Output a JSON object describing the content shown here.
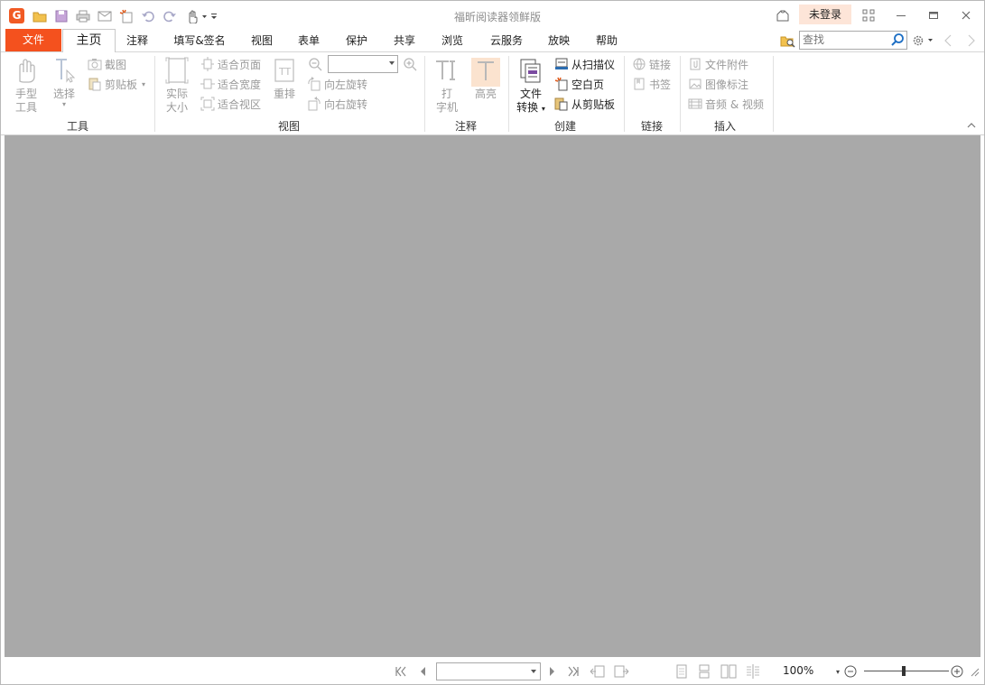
{
  "window": {
    "title": "福昕阅读器领鲜版"
  },
  "titlebar": {
    "logo_letter": "G",
    "login_label": "未登录"
  },
  "tabs": {
    "file": "文件",
    "items": [
      "主页",
      "注释",
      "填写&签名",
      "视图",
      "表单",
      "保护",
      "共享",
      "浏览",
      "云服务",
      "放映",
      "帮助"
    ],
    "active": "主页"
  },
  "search": {
    "placeholder": "查找"
  },
  "ribbon": {
    "tools": {
      "label": "工具",
      "hand_line1": "手型",
      "hand_line2": "工具",
      "select": "选择",
      "snapshot": "截图",
      "clipboard": "剪贴板"
    },
    "view": {
      "label": "视图",
      "actual_line1": "实际",
      "actual_line2": "大小",
      "fit_page": "适合页面",
      "fit_width": "适合宽度",
      "fit_visible": "适合视区",
      "reflow": "重排",
      "rotate_left": "向左旋转",
      "rotate_right": "向右旋转"
    },
    "comment": {
      "label": "注释",
      "typewriter_line1": "打",
      "typewriter_line2": "字机",
      "highlight": "高亮"
    },
    "create": {
      "label": "创建",
      "convert_line1": "文件",
      "convert_line2": "转换",
      "from_scanner": "从扫描仪",
      "blank_page": "空白页",
      "from_clipboard": "从剪贴板"
    },
    "link": {
      "label": "链接",
      "link": "链接",
      "bookmark": "书签"
    },
    "insert": {
      "label": "插入",
      "attachment": "文件附件",
      "image_annotation": "图像标注",
      "audio_video": "音频 & 视频"
    }
  },
  "statusbar": {
    "zoom": "100%"
  }
}
